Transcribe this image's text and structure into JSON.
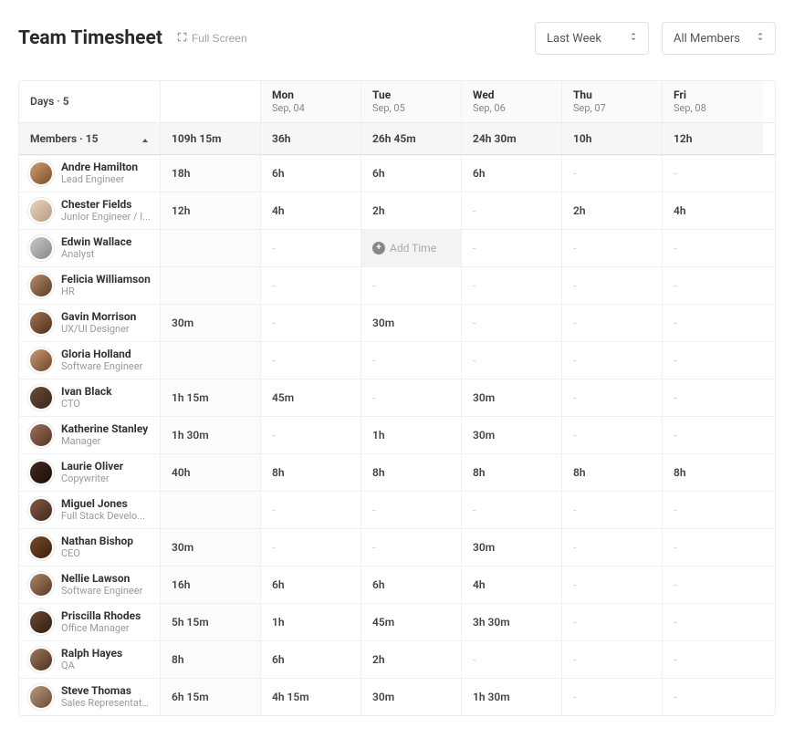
{
  "header": {
    "title": "Team Timesheet",
    "fullscreen_label": "Full Screen",
    "period_selector": {
      "selected": "Last Week"
    },
    "member_selector": {
      "selected": "All Members"
    }
  },
  "columns": {
    "days_label": "Days · 5",
    "members_label": "Members · 15",
    "total_hours": "109h 15m",
    "days": [
      {
        "weekday": "Mon",
        "date": "Sep, 04",
        "total": "36h"
      },
      {
        "weekday": "Tue",
        "date": "Sep, 05",
        "total": "26h 45m"
      },
      {
        "weekday": "Wed",
        "date": "Sep, 06",
        "total": "24h 30m"
      },
      {
        "weekday": "Thu",
        "date": "Sep, 07",
        "total": "10h"
      },
      {
        "weekday": "Fri",
        "date": "Sep, 08",
        "total": "12h"
      }
    ]
  },
  "add_time_label": "Add Time",
  "members": [
    {
      "name": "Andre Hamilton",
      "role": "Lead Engineer",
      "total": "18h",
      "hours": [
        "6h",
        "6h",
        "6h",
        "-",
        "-"
      ],
      "avatar": "av1"
    },
    {
      "name": "Chester Fields",
      "role": "Junior Engineer / I...",
      "total": "12h",
      "hours": [
        "4h",
        "2h",
        "-",
        "2h",
        "4h"
      ],
      "avatar": "av2"
    },
    {
      "name": "Edwin Wallace",
      "role": "Analyst",
      "total": "",
      "hours": [
        "-",
        "ADDTIME",
        "-",
        "-",
        "-"
      ],
      "avatar": "av3"
    },
    {
      "name": "Felicia Williamson",
      "role": "HR",
      "total": "",
      "hours": [
        "-",
        "-",
        "-",
        "-",
        "-"
      ],
      "avatar": "av4"
    },
    {
      "name": "Gavin Morrison",
      "role": "UX/UI Designer",
      "total": "30m",
      "hours": [
        "-",
        "30m",
        "-",
        "-",
        "-"
      ],
      "avatar": "av5"
    },
    {
      "name": "Gloria Holland",
      "role": "Software Engineer",
      "total": "",
      "hours": [
        "-",
        "-",
        "-",
        "-",
        "-"
      ],
      "avatar": "av6"
    },
    {
      "name": "Ivan Black",
      "role": "CTO",
      "total": "1h 15m",
      "hours": [
        "45m",
        "-",
        "30m",
        "-",
        "-"
      ],
      "avatar": "av7"
    },
    {
      "name": "Katherine Stanley",
      "role": "Manager",
      "total": "1h 30m",
      "hours": [
        "-",
        "1h",
        "30m",
        "-",
        "-"
      ],
      "avatar": "av8"
    },
    {
      "name": "Laurie Oliver",
      "role": "Copywriter",
      "total": "40h",
      "hours": [
        "8h",
        "8h",
        "8h",
        "8h",
        "8h"
      ],
      "avatar": "av9"
    },
    {
      "name": "Miguel Jones",
      "role": "Full Stack Develo...",
      "total": "",
      "hours": [
        "-",
        "-",
        "-",
        "-",
        "-"
      ],
      "avatar": "av10"
    },
    {
      "name": "Nathan Bishop",
      "role": "CEO",
      "total": "30m",
      "hours": [
        "-",
        "-",
        "30m",
        "-",
        "-"
      ],
      "avatar": "av11"
    },
    {
      "name": "Nellie Lawson",
      "role": "Software Engineer",
      "total": "16h",
      "hours": [
        "6h",
        "6h",
        "4h",
        "-",
        "-"
      ],
      "avatar": "av12"
    },
    {
      "name": "Priscilla Rhodes",
      "role": "Office Manager",
      "total": "5h 15m",
      "hours": [
        "1h",
        "45m",
        "3h 30m",
        "-",
        "-"
      ],
      "avatar": "av13"
    },
    {
      "name": "Ralph Hayes",
      "role": "QA",
      "total": "8h",
      "hours": [
        "6h",
        "2h",
        "-",
        "-",
        "-"
      ],
      "avatar": "av14"
    },
    {
      "name": "Steve Thomas",
      "role": "Sales Representati...",
      "total": "6h 15m",
      "hours": [
        "4h 15m",
        "30m",
        "1h 30m",
        "-",
        "-"
      ],
      "avatar": "av15"
    }
  ]
}
